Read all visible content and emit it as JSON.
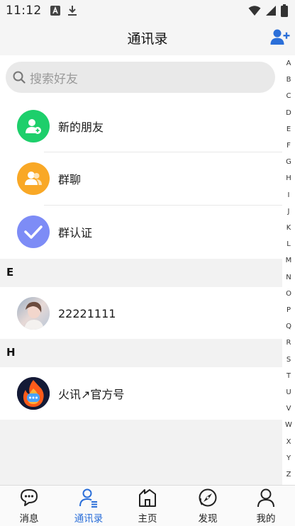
{
  "status_bar": {
    "time": "11:12",
    "icons": [
      "notification-a-icon",
      "download-icon",
      "wifi-icon",
      "signal-icon",
      "battery-icon"
    ]
  },
  "header": {
    "title": "通讯录",
    "add_friend_icon": "add-user-icon",
    "accent_color": "#2b6fd9"
  },
  "search": {
    "placeholder": "搜索好友"
  },
  "function_rows": [
    {
      "label": "新的朋友",
      "icon": "add-person-icon",
      "color": "#1dcf6b"
    },
    {
      "label": "群聊",
      "icon": "group-icon",
      "color": "#f9a826"
    },
    {
      "label": "群认证",
      "icon": "checkmark-icon",
      "color": "#7d8cf6"
    }
  ],
  "sections": [
    {
      "letter": "E",
      "contacts": [
        {
          "name": "22221111",
          "avatar": "photo-avatar"
        }
      ]
    },
    {
      "letter": "H",
      "contacts": [
        {
          "name": "火讯↗官方号",
          "avatar": "flame-logo-avatar"
        }
      ]
    }
  ],
  "alphabet_index": [
    "A",
    "B",
    "C",
    "D",
    "E",
    "F",
    "G",
    "H",
    "I",
    "J",
    "K",
    "L",
    "M",
    "N",
    "O",
    "P",
    "Q",
    "R",
    "S",
    "T",
    "U",
    "V",
    "W",
    "X",
    "Y",
    "Z"
  ],
  "bottom_nav": [
    {
      "label": "消息",
      "icon": "chat-bubble-icon",
      "active": false
    },
    {
      "label": "通讯录",
      "icon": "contacts-icon",
      "active": true
    },
    {
      "label": "主页",
      "icon": "home-icon",
      "active": false
    },
    {
      "label": "发现",
      "icon": "discover-icon",
      "active": false
    },
    {
      "label": "我的",
      "icon": "profile-icon",
      "active": false
    }
  ]
}
